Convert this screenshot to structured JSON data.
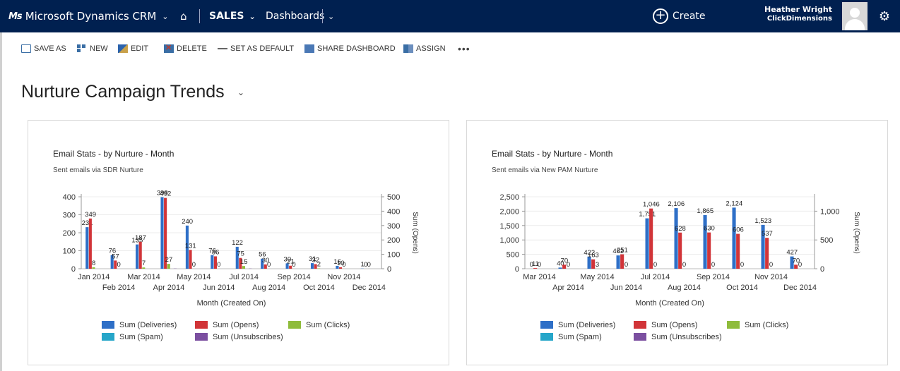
{
  "topbar": {
    "brand": "Microsoft Dynamics CRM",
    "logo_text": "Ms",
    "area": "SALES",
    "section": "Dashboards",
    "create_label": "Create",
    "user_name": "Heather Wright",
    "user_org": "ClickDimensions",
    "bg_color": "#002050"
  },
  "commands": {
    "save_as": "SAVE AS",
    "new": "NEW",
    "edit": "EDIT",
    "delete": "DELETE",
    "set_default": "SET AS DEFAULT",
    "share": "SHARE DASHBOARD",
    "assign": "ASSIGN",
    "more": "•••"
  },
  "page_title": "Nurture Campaign Trends",
  "charts": [
    {
      "title": "Email Stats - by Nurture - Month",
      "subtitle": "Sent emails via SDR Nurture"
    },
    {
      "title": "Email Stats - by Nurture - Month",
      "subtitle": "Sent emails via New PAM Nurture"
    }
  ],
  "chart_data": [
    {
      "type": "bar",
      "title": "Email Stats - by Nurture - Month",
      "subtitle": "Sent emails via SDR Nurture",
      "xlabel": "Month (Created On)",
      "ylabel": "",
      "y2label": "Sum (Opens)",
      "ylim": [
        0,
        400
      ],
      "y2lim": [
        0,
        500
      ],
      "yticks": [
        "0",
        "100",
        "200",
        "300",
        "400"
      ],
      "y2ticks": [
        "0",
        "100",
        "200",
        "300",
        "400",
        "500"
      ],
      "categories": [
        "Jan 2014",
        "Feb 2014",
        "Mar 2014",
        "Apr 2014",
        "May 2014",
        "Jun 2014",
        "Jul 2014",
        "Aug 2014",
        "Sep 2014",
        "Oct 2014",
        "Nov 2014",
        "Dec 2014"
      ],
      "series": [
        {
          "name": "Sum (Deliveries)",
          "color": "#2e6fc7",
          "values": [
            231,
            76,
            135,
            398,
            240,
            76,
            122,
            56,
            30,
            31,
            16,
            1
          ]
        },
        {
          "name": "Sum (Opens)",
          "color": "#d13438",
          "values": [
            349,
            57,
            187,
            492,
            131,
            86,
            75,
            30,
            21,
            32,
            10,
            0
          ]
        },
        {
          "name": "Sum (Clicks)",
          "color": "#8fbc3c",
          "values": [
            8,
            0,
            7,
            27,
            0,
            0,
            15,
            0,
            0,
            2,
            0,
            0
          ]
        },
        {
          "name": "Sum (Spam)",
          "color": "#26a6c9",
          "values": [
            0,
            0,
            0,
            0,
            0,
            0,
            0,
            0,
            0,
            0,
            0,
            0
          ]
        },
        {
          "name": "Sum (Unsubscribes)",
          "color": "#7b4fa0",
          "values": [
            0,
            0,
            0,
            1,
            0,
            0,
            1,
            0,
            0,
            0,
            0,
            0
          ]
        }
      ],
      "legend": "bottom"
    },
    {
      "type": "bar",
      "title": "Email Stats - by Nurture - Month",
      "subtitle": "Sent emails via New PAM Nurture",
      "xlabel": "Month (Created On)",
      "ylabel": "",
      "y2label": "Sum (Opens)",
      "ylim": [
        0,
        2500
      ],
      "y2lim": [
        0,
        1250
      ],
      "yticks": [
        "0",
        "500",
        "1,000",
        "1,500",
        "2,000",
        "2,500"
      ],
      "y2ticks": [
        "0",
        "500",
        "1,000"
      ],
      "categories": [
        "Mar 2014",
        "Apr 2014",
        "May 2014",
        "Jun 2014",
        "Jul 2014",
        "Aug 2014",
        "Sep 2014",
        "Oct 2014",
        "Nov 2014",
        "Dec 2014"
      ],
      "series": [
        {
          "name": "Sum (Deliveries)",
          "color": "#2e6fc7",
          "values": [
            0,
            40,
            422,
            462,
            1751,
            2106,
            1865,
            2124,
            1523,
            427
          ]
        },
        {
          "name": "Sum (Opens)",
          "color": "#d13438",
          "values": [
            11,
            70,
            163,
            251,
            1046,
            628,
            630,
            606,
            537,
            70
          ]
        },
        {
          "name": "Sum (Clicks)",
          "color": "#8fbc3c",
          "values": [
            0,
            0,
            3,
            0,
            0,
            0,
            0,
            0,
            0,
            0
          ]
        },
        {
          "name": "Sum (Spam)",
          "color": "#26a6c9",
          "values": [
            0,
            0,
            0,
            0,
            0,
            0,
            0,
            0,
            0,
            0
          ]
        },
        {
          "name": "Sum (Unsubscribes)",
          "color": "#7b4fa0",
          "values": [
            0,
            0,
            0,
            0,
            0,
            0,
            0,
            0,
            0,
            0
          ]
        }
      ],
      "legend": "bottom"
    }
  ]
}
